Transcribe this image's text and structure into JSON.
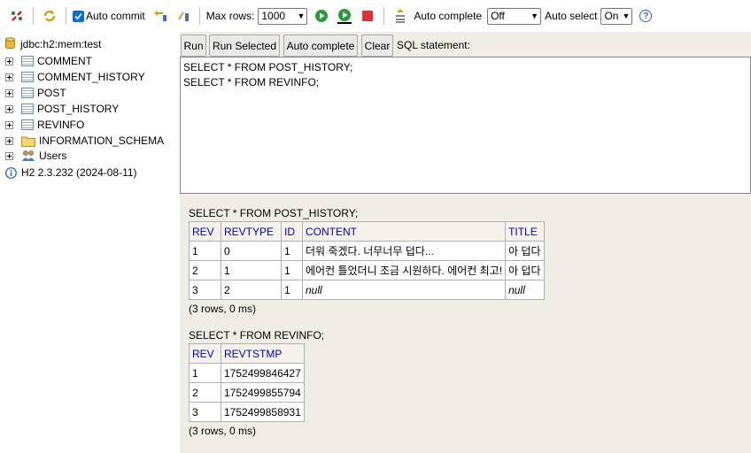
{
  "toolbar": {
    "auto_commit_label": "Auto commit",
    "max_rows_label": "Max rows:",
    "max_rows_value": "1000",
    "auto_complete_label": "Auto complete",
    "auto_complete_value": "Off",
    "auto_select_label": "Auto select",
    "auto_select_value": "On",
    "help_symbol": "?"
  },
  "tree": {
    "root": "jdbc:h2:mem:test",
    "items": [
      {
        "label": "COMMENT",
        "icon": "table-icon"
      },
      {
        "label": "COMMENT_HISTORY",
        "icon": "table-icon"
      },
      {
        "label": "POST",
        "icon": "table-icon"
      },
      {
        "label": "POST_HISTORY",
        "icon": "table-icon"
      },
      {
        "label": "REVINFO",
        "icon": "table-icon"
      },
      {
        "label": "INFORMATION_SCHEMA",
        "icon": "folder-icon"
      },
      {
        "label": "Users",
        "icon": "users-icon"
      }
    ],
    "version": "H2 2.3.232 (2024-08-11)"
  },
  "buttons": {
    "run": "Run",
    "run_selected": "Run Selected",
    "auto_complete": "Auto complete",
    "clear": "Clear",
    "sql_label": "SQL statement:"
  },
  "sql": {
    "line1": "SELECT * FROM POST_HISTORY;",
    "line2": "SELECT * FROM REVINFO;"
  },
  "results": [
    {
      "query": "SELECT * FROM POST_HISTORY;",
      "headers": [
        "REV",
        "REVTYPE",
        "ID",
        "CONTENT",
        "TITLE"
      ],
      "rows": [
        [
          "1",
          "0",
          "1",
          "더워 죽겠다. 너무너무 덥다...",
          "아 덥다"
        ],
        [
          "2",
          "1",
          "1",
          "에어컨 틀었더니 조금 시원하다. 에어컨 최고!",
          "아 덥다"
        ],
        [
          "3",
          "2",
          "1",
          "null",
          "null"
        ]
      ],
      "summary": "(3 rows, 0 ms)"
    },
    {
      "query": "SELECT * FROM REVINFO;",
      "headers": [
        "REV",
        "REVTSTMP"
      ],
      "rows": [
        [
          "1",
          "1752499846427"
        ],
        [
          "2",
          "1752499855794"
        ],
        [
          "3",
          "1752499858931"
        ]
      ],
      "summary": "(3 rows, 0 ms)"
    }
  ]
}
